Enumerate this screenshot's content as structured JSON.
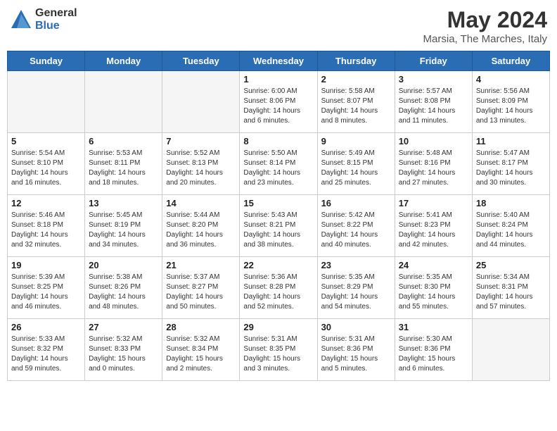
{
  "header": {
    "logo_general": "General",
    "logo_blue": "Blue",
    "title": "May 2024",
    "subtitle": "Marsia, The Marches, Italy"
  },
  "days_of_week": [
    "Sunday",
    "Monday",
    "Tuesday",
    "Wednesday",
    "Thursday",
    "Friday",
    "Saturday"
  ],
  "weeks": [
    [
      {
        "day": "",
        "info": ""
      },
      {
        "day": "",
        "info": ""
      },
      {
        "day": "",
        "info": ""
      },
      {
        "day": "1",
        "info": "Sunrise: 6:00 AM\nSunset: 8:06 PM\nDaylight: 14 hours\nand 6 minutes."
      },
      {
        "day": "2",
        "info": "Sunrise: 5:58 AM\nSunset: 8:07 PM\nDaylight: 14 hours\nand 8 minutes."
      },
      {
        "day": "3",
        "info": "Sunrise: 5:57 AM\nSunset: 8:08 PM\nDaylight: 14 hours\nand 11 minutes."
      },
      {
        "day": "4",
        "info": "Sunrise: 5:56 AM\nSunset: 8:09 PM\nDaylight: 14 hours\nand 13 minutes."
      }
    ],
    [
      {
        "day": "5",
        "info": "Sunrise: 5:54 AM\nSunset: 8:10 PM\nDaylight: 14 hours\nand 16 minutes."
      },
      {
        "day": "6",
        "info": "Sunrise: 5:53 AM\nSunset: 8:11 PM\nDaylight: 14 hours\nand 18 minutes."
      },
      {
        "day": "7",
        "info": "Sunrise: 5:52 AM\nSunset: 8:13 PM\nDaylight: 14 hours\nand 20 minutes."
      },
      {
        "day": "8",
        "info": "Sunrise: 5:50 AM\nSunset: 8:14 PM\nDaylight: 14 hours\nand 23 minutes."
      },
      {
        "day": "9",
        "info": "Sunrise: 5:49 AM\nSunset: 8:15 PM\nDaylight: 14 hours\nand 25 minutes."
      },
      {
        "day": "10",
        "info": "Sunrise: 5:48 AM\nSunset: 8:16 PM\nDaylight: 14 hours\nand 27 minutes."
      },
      {
        "day": "11",
        "info": "Sunrise: 5:47 AM\nSunset: 8:17 PM\nDaylight: 14 hours\nand 30 minutes."
      }
    ],
    [
      {
        "day": "12",
        "info": "Sunrise: 5:46 AM\nSunset: 8:18 PM\nDaylight: 14 hours\nand 32 minutes."
      },
      {
        "day": "13",
        "info": "Sunrise: 5:45 AM\nSunset: 8:19 PM\nDaylight: 14 hours\nand 34 minutes."
      },
      {
        "day": "14",
        "info": "Sunrise: 5:44 AM\nSunset: 8:20 PM\nDaylight: 14 hours\nand 36 minutes."
      },
      {
        "day": "15",
        "info": "Sunrise: 5:43 AM\nSunset: 8:21 PM\nDaylight: 14 hours\nand 38 minutes."
      },
      {
        "day": "16",
        "info": "Sunrise: 5:42 AM\nSunset: 8:22 PM\nDaylight: 14 hours\nand 40 minutes."
      },
      {
        "day": "17",
        "info": "Sunrise: 5:41 AM\nSunset: 8:23 PM\nDaylight: 14 hours\nand 42 minutes."
      },
      {
        "day": "18",
        "info": "Sunrise: 5:40 AM\nSunset: 8:24 PM\nDaylight: 14 hours\nand 44 minutes."
      }
    ],
    [
      {
        "day": "19",
        "info": "Sunrise: 5:39 AM\nSunset: 8:25 PM\nDaylight: 14 hours\nand 46 minutes."
      },
      {
        "day": "20",
        "info": "Sunrise: 5:38 AM\nSunset: 8:26 PM\nDaylight: 14 hours\nand 48 minutes."
      },
      {
        "day": "21",
        "info": "Sunrise: 5:37 AM\nSunset: 8:27 PM\nDaylight: 14 hours\nand 50 minutes."
      },
      {
        "day": "22",
        "info": "Sunrise: 5:36 AM\nSunset: 8:28 PM\nDaylight: 14 hours\nand 52 minutes."
      },
      {
        "day": "23",
        "info": "Sunrise: 5:35 AM\nSunset: 8:29 PM\nDaylight: 14 hours\nand 54 minutes."
      },
      {
        "day": "24",
        "info": "Sunrise: 5:35 AM\nSunset: 8:30 PM\nDaylight: 14 hours\nand 55 minutes."
      },
      {
        "day": "25",
        "info": "Sunrise: 5:34 AM\nSunset: 8:31 PM\nDaylight: 14 hours\nand 57 minutes."
      }
    ],
    [
      {
        "day": "26",
        "info": "Sunrise: 5:33 AM\nSunset: 8:32 PM\nDaylight: 14 hours\nand 59 minutes."
      },
      {
        "day": "27",
        "info": "Sunrise: 5:32 AM\nSunset: 8:33 PM\nDaylight: 15 hours\nand 0 minutes."
      },
      {
        "day": "28",
        "info": "Sunrise: 5:32 AM\nSunset: 8:34 PM\nDaylight: 15 hours\nand 2 minutes."
      },
      {
        "day": "29",
        "info": "Sunrise: 5:31 AM\nSunset: 8:35 PM\nDaylight: 15 hours\nand 3 minutes."
      },
      {
        "day": "30",
        "info": "Sunrise: 5:31 AM\nSunset: 8:36 PM\nDaylight: 15 hours\nand 5 minutes."
      },
      {
        "day": "31",
        "info": "Sunrise: 5:30 AM\nSunset: 8:36 PM\nDaylight: 15 hours\nand 6 minutes."
      },
      {
        "day": "",
        "info": ""
      }
    ]
  ]
}
